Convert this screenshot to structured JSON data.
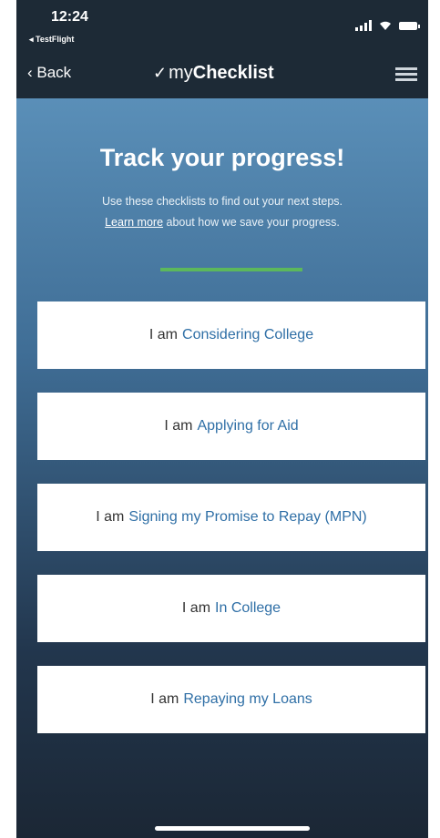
{
  "status": {
    "time": "12:24",
    "back_app": "◂ TestFlight"
  },
  "nav": {
    "back_label": "‹ Back",
    "title_prefix": "my",
    "title_bold": "Checklist",
    "icons": [
      "checkmark-icon",
      "menu-icon"
    ]
  },
  "hero": {
    "headline": "Track your progress!",
    "subtext_line1": "Use these checklists to find out your next steps.",
    "learn_more": "Learn more",
    "subtext_line2_rest": " about how we save your progress.",
    "divider_color": "#5cb85c"
  },
  "options": [
    {
      "prefix": "I am",
      "label": "Considering College"
    },
    {
      "prefix": "I am",
      "label": "Applying for Aid"
    },
    {
      "prefix": "I am",
      "label": "Signing my Promise to Repay (MPN)"
    },
    {
      "prefix": "I am",
      "label": "In College"
    },
    {
      "prefix": "I am",
      "label": "Repaying my Loans"
    }
  ],
  "colors": {
    "accent_link": "#2f6fa6",
    "nav_bg": "#1d2a36",
    "gradient_top": "#5a8fb8"
  }
}
